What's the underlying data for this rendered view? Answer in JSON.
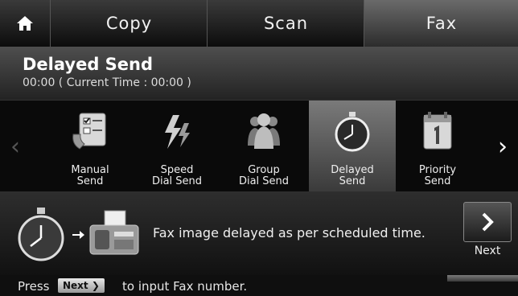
{
  "tabs": [
    {
      "label": "Copy"
    },
    {
      "label": "Scan"
    },
    {
      "label": "Fax",
      "selected": true
    }
  ],
  "header": {
    "title": "Delayed Send",
    "subtitle": "00:00 ( Current Time : 00:00 )"
  },
  "options": [
    {
      "line1": "Manual",
      "line2": "Send",
      "icon": "manual-send-icon"
    },
    {
      "line1": "Speed",
      "line2": "Dial Send",
      "icon": "speed-dial-icon"
    },
    {
      "line1": "Group",
      "line2": "Dial Send",
      "icon": "group-dial-icon"
    },
    {
      "line1": "Delayed",
      "line2": "Send",
      "icon": "clock-icon",
      "selected": true
    },
    {
      "line1": "Priority",
      "line2": "Send",
      "icon": "priority-send-icon"
    }
  ],
  "message": {
    "text": "Fax image delayed as per scheduled time.",
    "next_label": "Next"
  },
  "hint": {
    "press": "Press",
    "key": "Next",
    "rest": "to input Fax number."
  }
}
